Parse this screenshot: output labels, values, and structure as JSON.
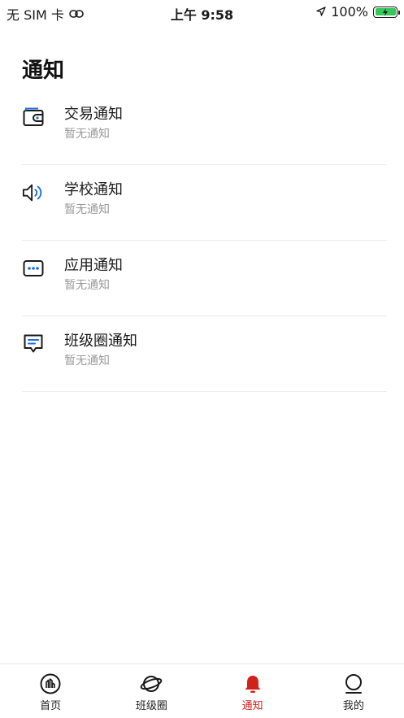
{
  "status_bar": {
    "carrier": "无 SIM 卡",
    "time": "上午 9:58",
    "battery": "100%"
  },
  "page": {
    "title": "通知"
  },
  "notifications": [
    {
      "title": "交易通知",
      "subtitle": "暂无通知",
      "icon": "wallet-icon"
    },
    {
      "title": "学校通知",
      "subtitle": "暂无通知",
      "icon": "speaker-icon"
    },
    {
      "title": "应用通知",
      "subtitle": "暂无通知",
      "icon": "apps-icon"
    },
    {
      "title": "班级圈通知",
      "subtitle": "暂无通知",
      "icon": "message-icon"
    }
  ],
  "tab_bar": {
    "tabs": [
      {
        "label": "首页",
        "icon": "home-icon"
      },
      {
        "label": "班级圈",
        "icon": "planet-icon"
      },
      {
        "label": "通知",
        "icon": "bell-icon",
        "active": true
      },
      {
        "label": "我的",
        "icon": "profile-icon"
      }
    ]
  },
  "colors": {
    "accent": "#d0211c",
    "icon_blue": "#1e6fd9",
    "battery_green": "#34c759"
  }
}
